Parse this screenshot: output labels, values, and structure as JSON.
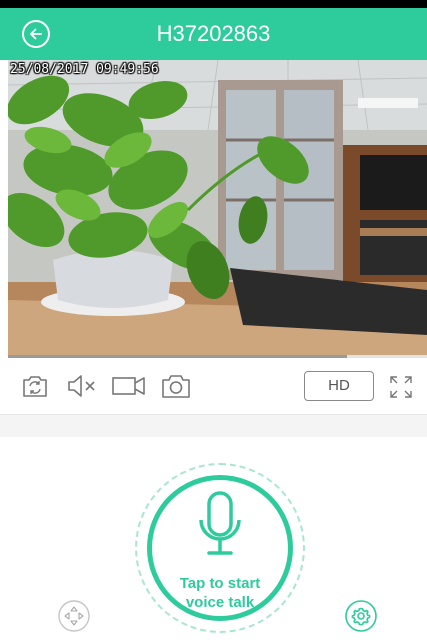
{
  "header": {
    "title": "H37202863"
  },
  "video": {
    "timestamp": "25/08/2017 09:49:56",
    "progress": 0.81
  },
  "toolbar": {
    "hd_label": "HD",
    "icons": [
      "camera-switch-icon",
      "speaker-muted-icon",
      "video-record-icon",
      "snapshot-icon",
      "fullscreen-icon"
    ]
  },
  "talk": {
    "line1": "Tap to start",
    "line2": "voice talk"
  },
  "colors": {
    "accent": "#2ecb9c",
    "accent_light": "#a9e6d2",
    "icon_gray": "#777777"
  },
  "corner_icons": [
    "ptz-direction-icon",
    "settings-gear-icon"
  ]
}
